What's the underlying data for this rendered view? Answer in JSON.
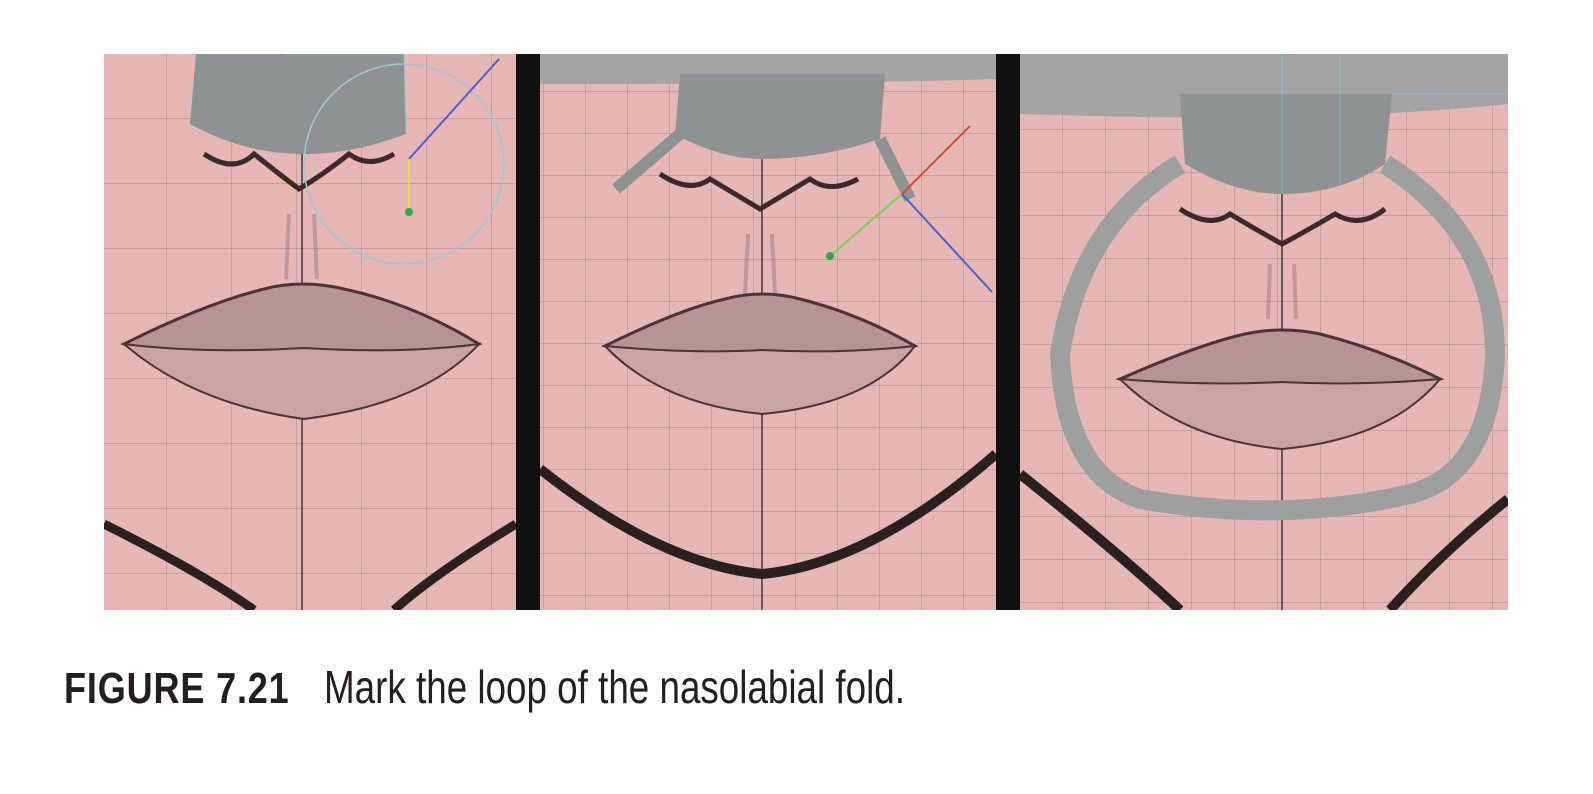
{
  "figure": {
    "label": "FIGURE   7.21",
    "caption": "Mark the loop of the nasolabial fold.",
    "panels": [
      {
        "id": "panel-1"
      },
      {
        "id": "panel-2"
      },
      {
        "id": "panel-3"
      }
    ],
    "colors": {
      "skin": "#e6b7b5",
      "grid": "#7a5f5f",
      "mesh": "#9ea0a0",
      "wire": "#7fd3c9",
      "divider": "#111111"
    }
  }
}
